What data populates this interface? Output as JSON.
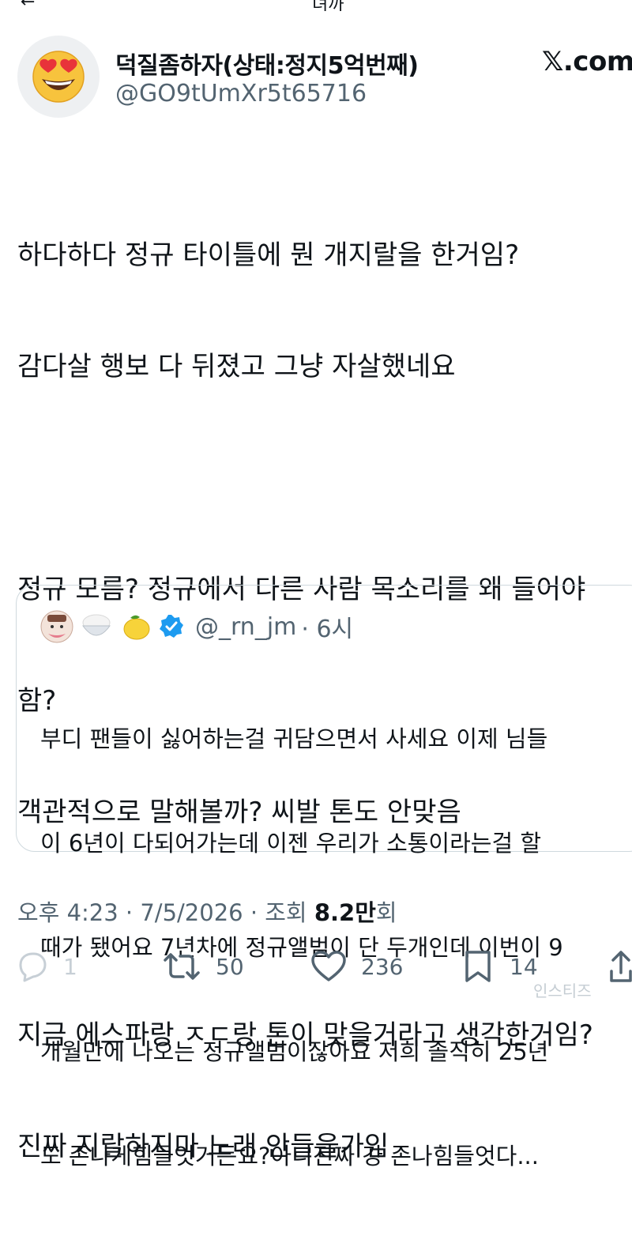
{
  "top_fragment": "녀까",
  "author": {
    "name": "덕질좀하자(상태:정지5억번째)",
    "handle": "@GO9tUmXr5t65716",
    "avatar_icon": "heart-eyes-emoji"
  },
  "brand": "𝕏.com",
  "tweet_lines": [
    "하다하다 정규 타이틀에 뭔 개지랄을 한거임?",
    "감다살 행보 다 뒤졌고 그냥 자살했네요",
    "",
    "정규 모름? 정규에서 다른 사람 목소리를 왜 들어야",
    "함?",
    "객관적으로 말해볼까? 씨발 톤도 안맞음",
    "",
    "지금 에스파랑 ㅈㄷ랑 톤이 맞을거라고 생각한거임?",
    "진짜 지랄하지마 노래 안들을가임"
  ],
  "quote": {
    "handle": "@_rn_jm",
    "time": "· 6시",
    "verified_color": "#1d9bf0",
    "lines": [
      "부디 팬들이 싫어하는걸 귀담으면서 사세요 이제 님들",
      "이 6년이 다되어가는데 이젠 우리가 소통이라는걸 할",
      "때가 됐어요 7년차에 정규앨범이 단 두개인데 이번이 9",
      "개월만에 나오는 정규앨범이잖아요 저희 솔직히 25년",
      "도 존나게힘들엇거든요?아니진짜 걍 존나힘들엇다..."
    ]
  },
  "meta": {
    "time": "오후 4:23 · 7/5/2026 · 조회 ",
    "views": "8.2만",
    "views_suffix": "회"
  },
  "actions": {
    "reply_count": "1",
    "retweet_count": "50",
    "like_count": "236",
    "bookmark_count": "14"
  },
  "watermark": "인스티즈"
}
